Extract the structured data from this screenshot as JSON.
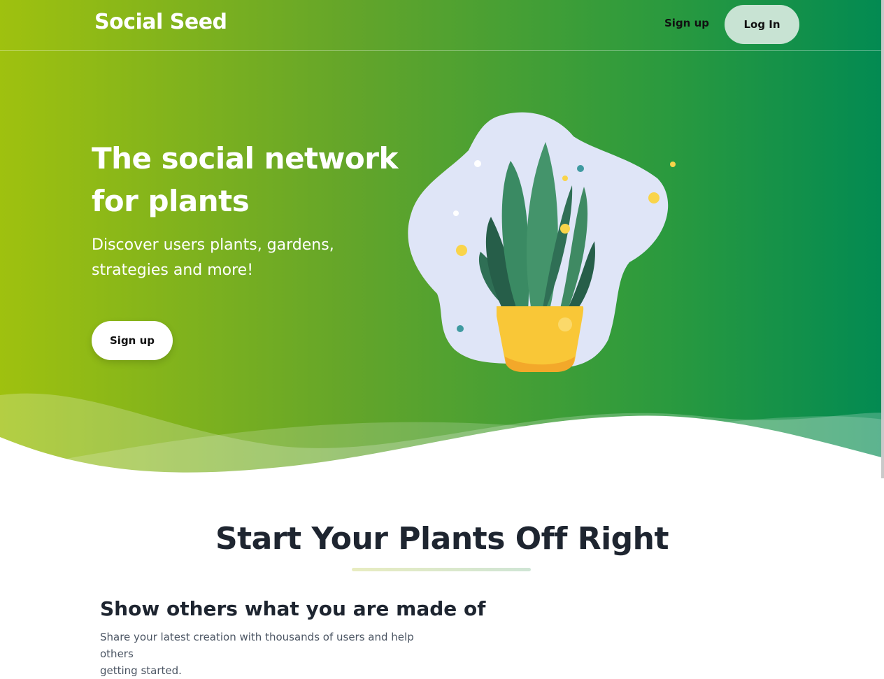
{
  "nav": {
    "logo": "Social Seed",
    "signup_label": "Sign up",
    "login_label": "Log In"
  },
  "hero": {
    "headline_line1": "The social network",
    "headline_line2": "for plants",
    "subtext_line1": "Discover users plants, gardens,",
    "subtext_line2": "strategies and more!",
    "signup_label": "Sign up"
  },
  "section": {
    "title": "Start Your Plants Off Right"
  },
  "feature": {
    "title": "Show others what you are made of",
    "desc_line1": "Share your latest creation with thousands of users and help others",
    "desc_line2": "getting started."
  },
  "colors": {
    "gradient_start": "#9fc10f",
    "gradient_end": "#028a52",
    "pot": "#f9c737",
    "login_bg": "#c8e3d3"
  }
}
